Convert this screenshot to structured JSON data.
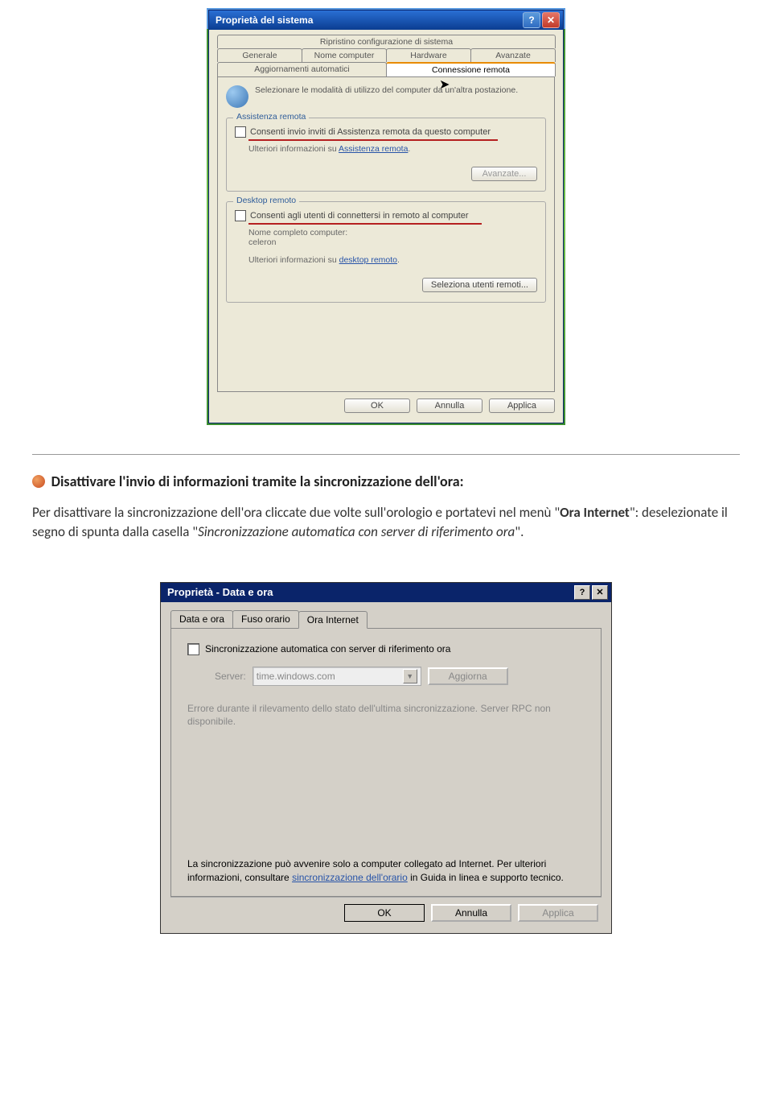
{
  "dialog1": {
    "title": "Proprietà del sistema",
    "tabs_top": "Ripristino configurazione di sistema",
    "tabs_mid": [
      "Generale",
      "Nome computer",
      "Hardware",
      "Avanzate"
    ],
    "tabs_bot": [
      "Aggiornamenti automatici",
      "Connessione remota"
    ],
    "intro": "Selezionare le modalità di utilizzo del computer da un'altra postazione.",
    "g1_title": "Assistenza remota",
    "g1_chk": "Consenti invio inviti di Assistenza remota da questo computer",
    "g1_info_pre": "Ulteriori informazioni su ",
    "g1_link": "Assistenza remota",
    "g1_btn": "Avanzate...",
    "g2_title": "Desktop remoto",
    "g2_chk": "Consenti agli utenti di connettersi in remoto al computer",
    "g2_name_lbl": "Nome completo computer:",
    "g2_name_val": "celeron",
    "g2_info_pre": "Ulteriori informazioni su ",
    "g2_link": "desktop remoto",
    "g2_btn": "Seleziona utenti remoti...",
    "ok": "OK",
    "cancel": "Annulla",
    "apply": "Applica"
  },
  "text": {
    "heading": "Disattivare l'invio di informazioni tramite la sincronizzazione dell'ora:",
    "p1a": "Per disattivare la sincronizzazione dell'ora cliccate due volte sull'orologio e portatevi nel menù \"",
    "p1b": "Ora Internet",
    "p1c": "\": deselezionate il segno di spunta dalla casella \"",
    "p1d": "Sincronizzazione automatica con server di riferimento ora",
    "p1e": "\"."
  },
  "dialog2": {
    "title": "Proprietà - Data e ora",
    "tabs": [
      "Data e ora",
      "Fuso orario",
      "Ora Internet"
    ],
    "chk": "Sincronizzazione automatica con server di riferimento ora",
    "srv_lbl": "Server:",
    "srv_val": "time.windows.com",
    "upd_btn": "Aggiorna",
    "err": "Errore durante il rilevamento dello stato dell'ultima sincronizzazione. Server RPC non disponibile.",
    "footer_pre": "La sincronizzazione può avvenire solo a computer collegato ad Internet. Per ulteriori informazioni, consultare ",
    "footer_link": "sincronizzazione dell'orario",
    "footer_post": " in Guida in linea e supporto tecnico.",
    "ok": "OK",
    "cancel": "Annulla",
    "apply": "Applica"
  }
}
